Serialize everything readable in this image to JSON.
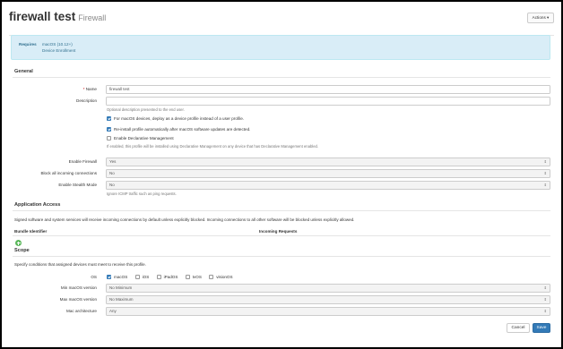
{
  "header": {
    "title": "firewall test",
    "subtitle": "Firewall",
    "actions_label": "Actions ▾"
  },
  "requires": {
    "label": "Requires",
    "items": [
      "macOS (10.12+)",
      "Device Enrollment"
    ]
  },
  "general": {
    "section_title": "General",
    "name_label": "Name",
    "name_required_mark": "*",
    "name_value": "firewall test",
    "description_label": "Description",
    "description_value": "",
    "description_help": "Optional description presented to the end user.",
    "checkboxes": [
      {
        "label": "For macOS devices, deploy as a device profile instead of a user profile.",
        "checked": true
      },
      {
        "label": "Re-install profile automatically after macOS software updates are detected.",
        "checked": true
      },
      {
        "label": "Enable Declarative Management",
        "checked": false
      }
    ],
    "declarative_help": "If enabled, this profile will be installed using Declarative Management on any device that has Declarative Management enabled."
  },
  "firewall": {
    "enable_firewall_label": "Enable Firewall",
    "enable_firewall_value": "Yes",
    "block_incoming_label": "Block all incoming connections",
    "block_incoming_value": "No",
    "stealth_label": "Enable Stealth Mode",
    "stealth_value": "No",
    "stealth_help": "Ignore ICMP traffic such as ping requests."
  },
  "app_access": {
    "section_title": "Application Access",
    "description": "Signed software and system services will receive incoming connections by default unless explicitly blocked. Incoming connections to all other software will be blocked unless explicitly allowed.",
    "col_bundle": "Bundle Identifier",
    "col_incoming": "Incoming Requests"
  },
  "scope": {
    "section_title": "Scope",
    "description": "Specify conditions that assigned devices must meet to receive this profile.",
    "os_label": "OS",
    "os_options": [
      {
        "label": "macOS",
        "checked": true
      },
      {
        "label": "iOS",
        "checked": false
      },
      {
        "label": "iPadOS",
        "checked": false
      },
      {
        "label": "tvOS",
        "checked": false
      },
      {
        "label": "visionOS",
        "checked": false
      }
    ],
    "min_label": "Min macOS version",
    "min_value": "No Minimum",
    "max_label": "Max macOS version",
    "max_value": "No Maximum",
    "arch_label": "Mac architecture",
    "arch_value": "Any"
  },
  "footer": {
    "cancel_label": "Cancel",
    "save_label": "Save"
  },
  "colors": {
    "primary": "#337ab7",
    "info_bg": "#d9edf7",
    "add": "#5cb85c"
  }
}
